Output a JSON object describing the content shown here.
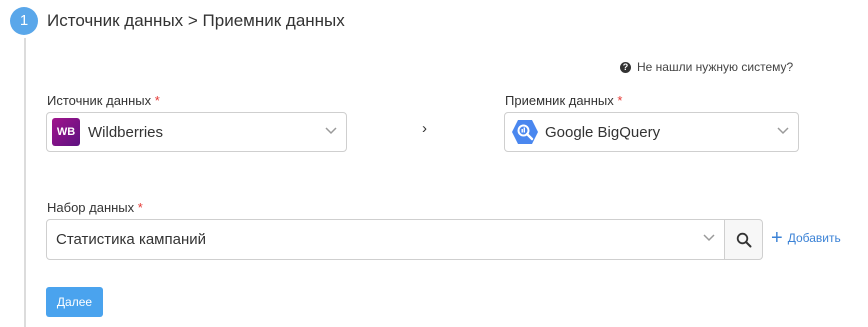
{
  "step": {
    "number": "1",
    "title": "Источник данных > Приемник данных"
  },
  "help": {
    "icon": "question-circle-icon",
    "text": "Не нашли нужную систему?"
  },
  "source": {
    "label": "Источник данных",
    "required_mark": "*",
    "logo_text": "WB",
    "value": "Wildberries"
  },
  "arrow": "›",
  "destination": {
    "label": "Приемник данных",
    "required_mark": "*",
    "value": "Google BigQuery"
  },
  "dataset": {
    "label": "Набор данных",
    "required_mark": "*",
    "value": "Статистика кампаний",
    "search_icon": "search-icon"
  },
  "add": {
    "plus": "+",
    "label": "Добавить"
  },
  "next_button": "Далее",
  "colors": {
    "accent": "#4aa3ee",
    "link": "#3b82d6",
    "required": "#e53935",
    "wb_brand": "#8b1384"
  }
}
